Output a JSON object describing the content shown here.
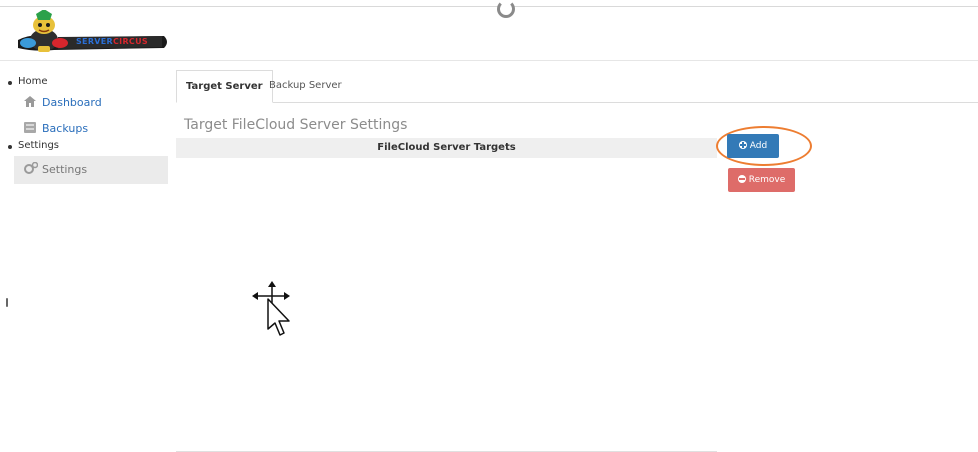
{
  "brand": {
    "logo_part1": "SERVER",
    "logo_part2": "CIRCUS"
  },
  "sidebar": {
    "sections": [
      {
        "label": "Home",
        "items": [
          {
            "label": "Dashboard",
            "icon": "home-icon"
          },
          {
            "label": "Backups",
            "icon": "backups-icon"
          }
        ]
      },
      {
        "label": "Settings",
        "items": [
          {
            "label": "Settings",
            "icon": "gears-icon",
            "active": true
          }
        ]
      }
    ]
  },
  "tabs": [
    {
      "label": "Target Server",
      "active": true
    },
    {
      "label": "Backup Server",
      "active": false
    }
  ],
  "main": {
    "title": "Target FileCloud Server Settings",
    "table": {
      "header": "FileCloud Server Targets",
      "rows": []
    },
    "buttons": {
      "add": "Add",
      "remove": "Remove"
    }
  },
  "colors": {
    "primary": "#337ab7",
    "danger": "#d9534f",
    "highlight": "#ed7d31",
    "link": "#2a6ebb"
  }
}
